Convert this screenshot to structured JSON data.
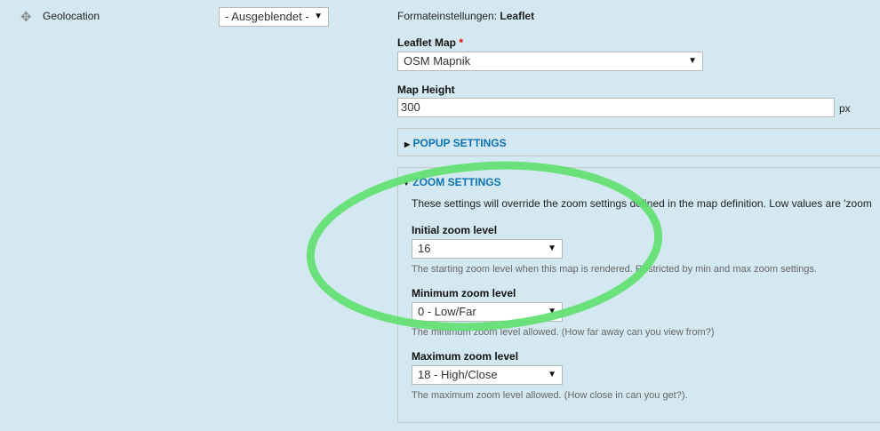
{
  "row": {
    "field_label": "Geolocation",
    "visibility_select": "- Ausgeblendet -"
  },
  "format": {
    "title_prefix": "Formateinstellungen:",
    "title_value": "Leaflet",
    "leaflet_map": {
      "label": "Leaflet Map",
      "required_mark": "*",
      "value": "OSM Mapnik"
    },
    "map_height": {
      "label": "Map Height",
      "value": "300",
      "unit": "px"
    }
  },
  "popup": {
    "legend": "POPUP SETTINGS"
  },
  "zoom": {
    "legend": "ZOOM SETTINGS",
    "description": "These settings will override the zoom settings defined in the map definition. Low values are 'zoom",
    "initial": {
      "label": "Initial zoom level",
      "value": "16",
      "desc": "The starting zoom level when this map is rendered. Restricted by min and max zoom settings."
    },
    "minimum": {
      "label": "Minimum zoom level",
      "value": "0 - Low/Far",
      "desc": "The minimum zoom level allowed. (How far away can you view from?)"
    },
    "maximum": {
      "label": "Maximum zoom level",
      "value": "18 - High/Close",
      "desc": "The maximum zoom level allowed. (How close in can you get?)."
    }
  },
  "annotation_color": "#5ee06e"
}
